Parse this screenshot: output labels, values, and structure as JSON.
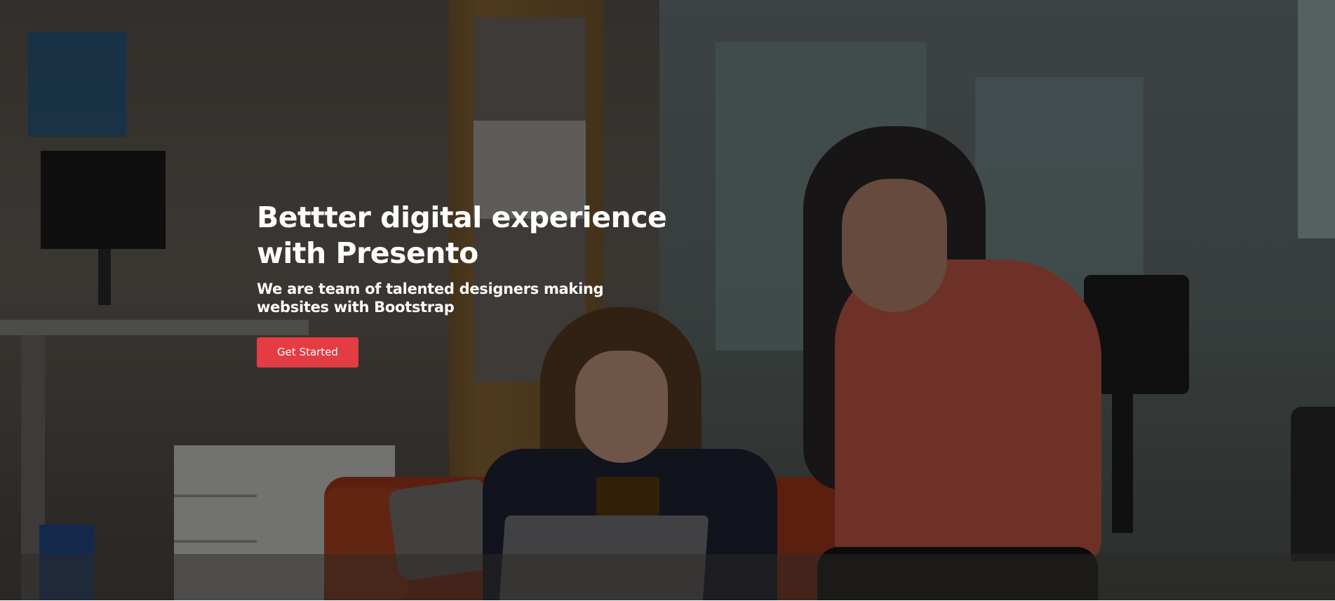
{
  "hero": {
    "title_line1": "Bettter digital experience",
    "title_line2": "with Presento",
    "subtitle": "We are team of talented designers making websites with Bootstrap",
    "cta_label": "Get Started",
    "accent_color": "#e43c43"
  }
}
